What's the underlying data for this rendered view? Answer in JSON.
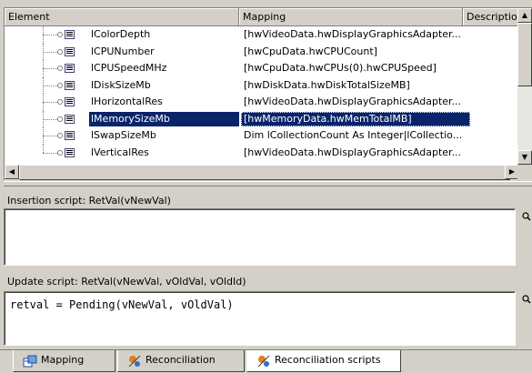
{
  "grid": {
    "columns": {
      "element": "Element",
      "mapping": "Mapping",
      "description": "Description"
    },
    "rows": [
      {
        "name": "lColorDepth",
        "mapping": "[hwVideoData.hwDisplayGraphicsAdapter..."
      },
      {
        "name": "lCPUNumber",
        "mapping": "[hwCpuData.hwCPUCount]"
      },
      {
        "name": "lCPUSpeedMHz",
        "mapping": "[hwCpuData.hwCPUs(0).hwCPUSpeed]"
      },
      {
        "name": "lDiskSizeMb",
        "mapping": "[hwDiskData.hwDiskTotalSizeMB]"
      },
      {
        "name": "lHorizontalRes",
        "mapping": "[hwVideoData.hwDisplayGraphicsAdapter..."
      },
      {
        "name": "lMemorySizeMb",
        "mapping": "[hwMemoryData.hwMemTotalMB]",
        "selected": true
      },
      {
        "name": "lSwapSizeMb",
        "mapping": "Dim lCollectionCount As Integer|lCollectio..."
      },
      {
        "name": "lVerticalRes",
        "mapping": "[hwVideoData.hwDisplayGraphicsAdapter..."
      }
    ]
  },
  "insertion": {
    "label": "Insertion script: RetVal(vNewVal)",
    "code": ""
  },
  "update": {
    "label": "Update script: RetVal(vNewVal, vOldVal, vOldId)",
    "code": "retval = Pending(vNewVal, vOldVal)"
  },
  "tabs": [
    {
      "label": "Mapping",
      "icon": "mapping-icon"
    },
    {
      "label": "Reconciliation",
      "icon": "reconciliation-icon"
    },
    {
      "label": "Reconciliation scripts",
      "icon": "reconciliation-scripts-icon",
      "active": true
    }
  ],
  "colors": {
    "selection": "#0a246a",
    "face": "#d4d0c8"
  }
}
